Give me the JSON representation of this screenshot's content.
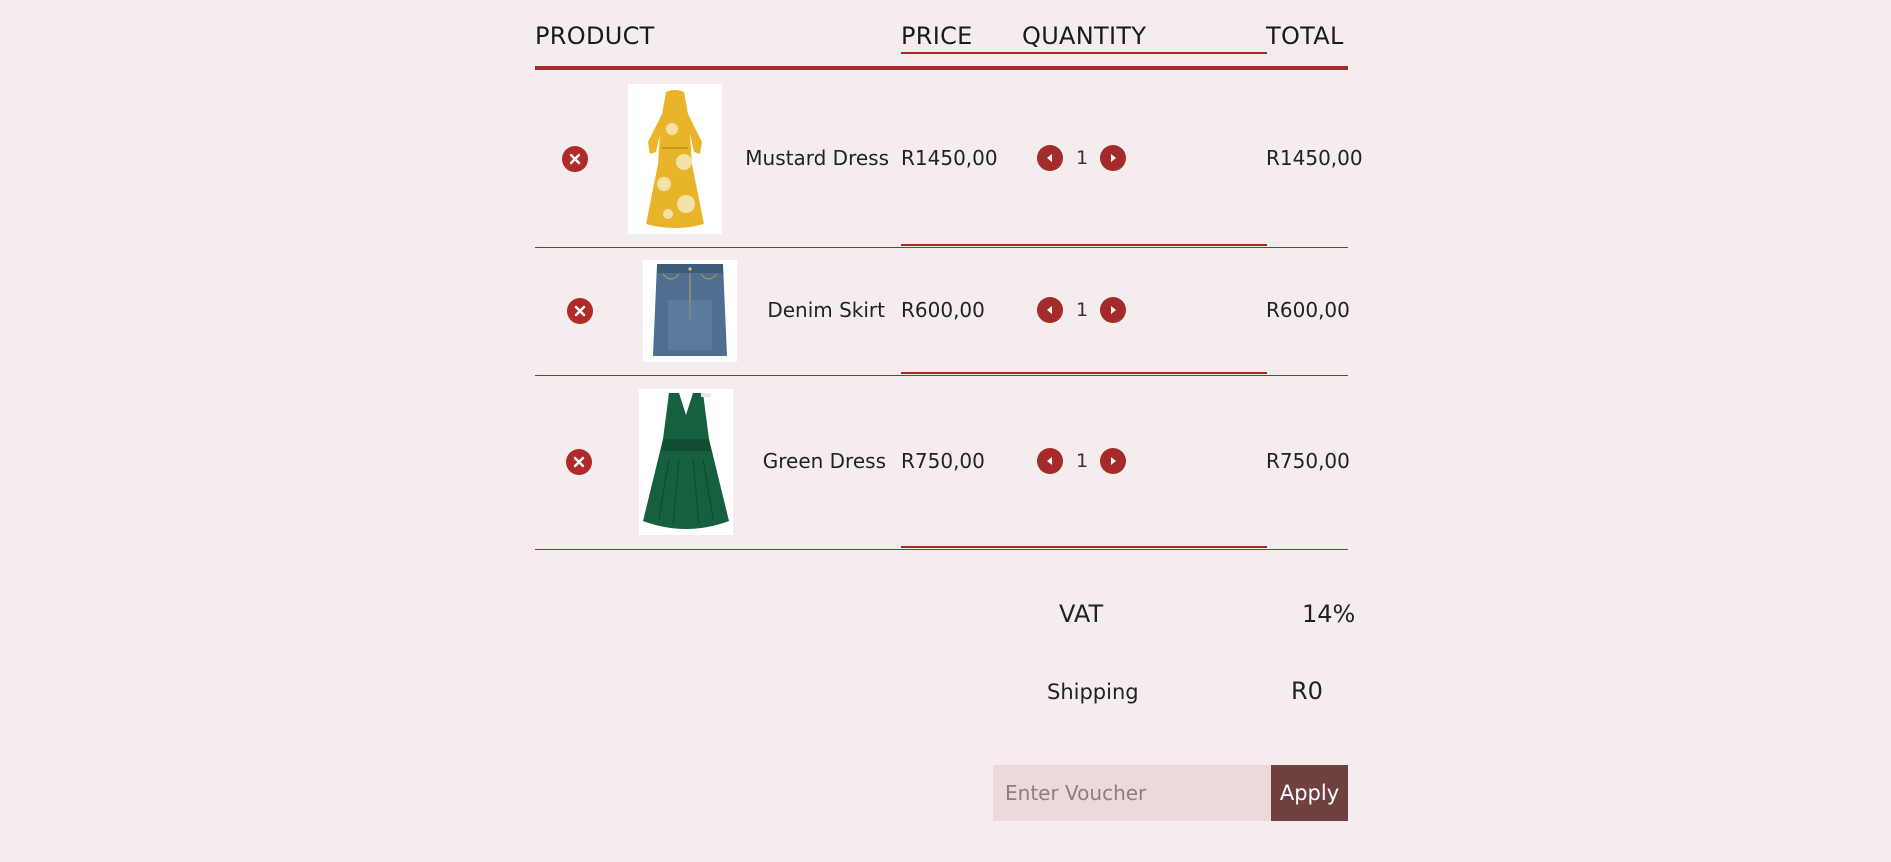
{
  "header": {
    "product": "PRODUCT",
    "price": "PRICE",
    "quantity": "QUANTITY",
    "total": "TOTAL"
  },
  "items": [
    {
      "name": "Mustard Dress",
      "price": "R1450,00",
      "quantity": "1",
      "total": "R1450,00",
      "image": "mustard-dress"
    },
    {
      "name": "Denim Skirt",
      "price": "R600,00",
      "quantity": "1",
      "total": "R600,00",
      "image": "denim-skirt"
    },
    {
      "name": "Green Dress",
      "price": "R750,00",
      "quantity": "1",
      "total": "R750,00",
      "image": "green-dress"
    }
  ],
  "summary": {
    "vat_label": "VAT",
    "vat_value": "14%",
    "shipping_label": "Shipping",
    "shipping_value": "R0"
  },
  "voucher": {
    "placeholder": "Enter Voucher",
    "apply_label": "Apply"
  },
  "icons": {
    "remove": "close-circle-icon",
    "decrease": "caret-left-icon",
    "increase": "caret-right-icon"
  },
  "colors": {
    "accent": "#a52a2a",
    "background": "#f5eded",
    "apply_button": "#6e4040",
    "voucher_field": "#ecd9d9"
  }
}
